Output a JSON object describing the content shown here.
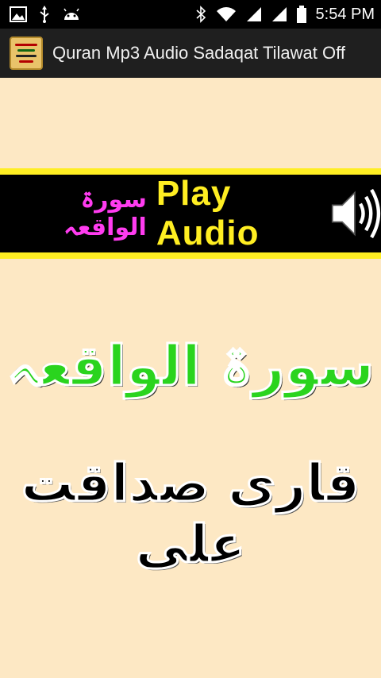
{
  "status_bar": {
    "time": "5:54 PM",
    "left_icons": [
      "image-icon",
      "usb-icon",
      "android-icon"
    ],
    "right_icons": [
      "bluetooth-icon",
      "wifi-icon",
      "signal-icon",
      "signal-icon",
      "battery-icon"
    ]
  },
  "action_bar": {
    "title": "Quran Mp3 Audio Sadaqat Tilawat Off"
  },
  "banner": {
    "urdu_label": "سورۃ الواقعہ",
    "play_label": "Play  Audio",
    "icon": "speaker-icon"
  },
  "content": {
    "surah_name": "سورۃ الواقعہ",
    "qari_name": "قاری صداقت علی"
  },
  "colors": {
    "background": "#fde8c4",
    "banner_border": "#ffee22",
    "banner_bg": "#000000",
    "play_text": "#ffee22",
    "urdu_banner_text": "#ff3cf0",
    "surah_text": "#2ad41e"
  }
}
